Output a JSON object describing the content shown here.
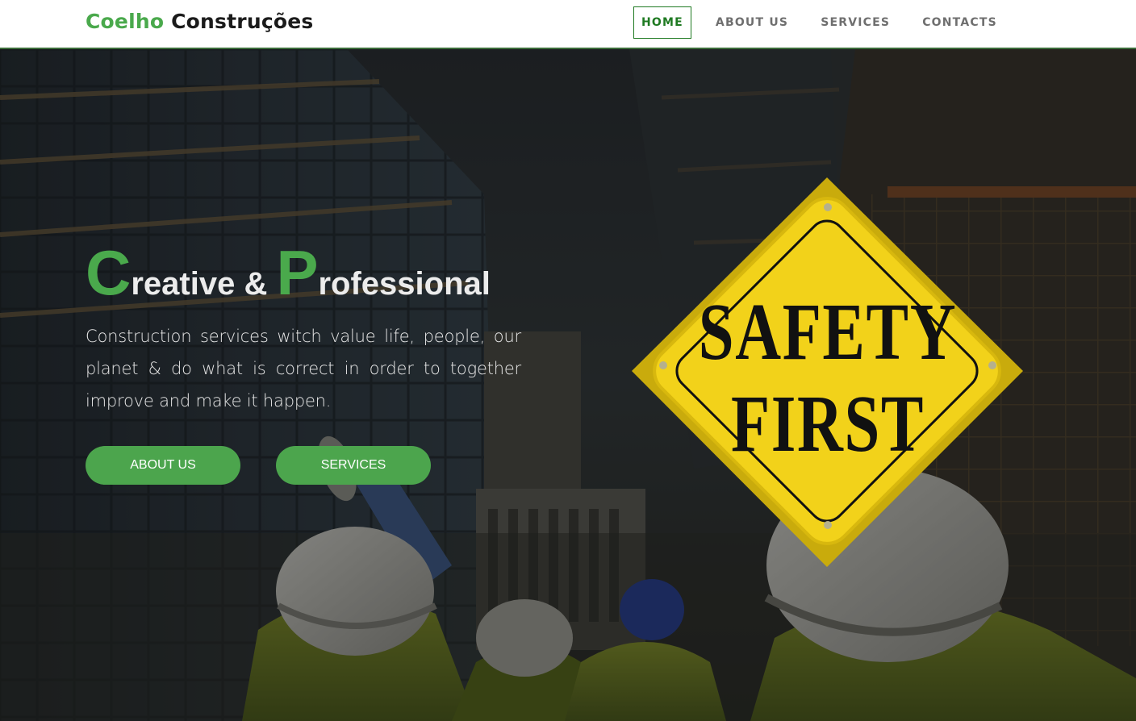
{
  "brand": {
    "first": "Coelho",
    "second": " Construções"
  },
  "nav": {
    "items": [
      {
        "label": "HOME",
        "active": true
      },
      {
        "label": "ABOUT US",
        "active": false
      },
      {
        "label": "SERVICES",
        "active": false
      },
      {
        "label": "CONTACTS",
        "active": false
      }
    ]
  },
  "hero": {
    "headline": {
      "cap1": "C",
      "rest1": "reative & ",
      "cap2": "P",
      "rest2": "rofessional"
    },
    "subtitle": "Construction services witch value life, people, our planet & do what is correct in order to together improve and make it happen.",
    "buttons": {
      "about": "ABOUT US",
      "services": "SERVICES"
    },
    "sign": {
      "line1": "SAFETY",
      "line2": "FIRST"
    }
  },
  "colors": {
    "brand_green": "#4aa94c",
    "button_green": "#4ca54d",
    "nav_active": "#1f7a22",
    "sign_yellow": "#f2d21a"
  }
}
